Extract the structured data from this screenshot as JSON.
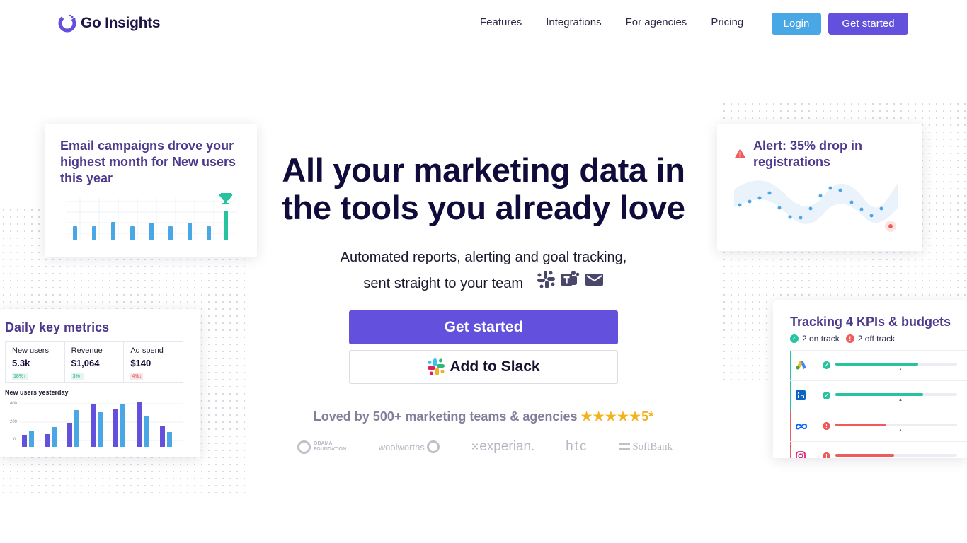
{
  "brand": {
    "name": "Go Insights"
  },
  "nav": {
    "links": [
      "Features",
      "Integrations",
      "For agencies",
      "Pricing"
    ],
    "login": "Login",
    "get_started": "Get started"
  },
  "hero": {
    "title": "All your marketing data in the tools you already love",
    "subtitle_line1": "Automated reports, alerting and goal tracking,",
    "subtitle_line2": "sent straight to your team",
    "cta_primary": "Get started",
    "cta_slack": "Add to Slack",
    "loved": "Loved by 500+ marketing teams & agencies",
    "rating": "5*",
    "customer_logos": [
      "OBAMA FOUNDATION",
      "woolworths",
      "experian.",
      "htc",
      "SoftBank"
    ]
  },
  "email_card": {
    "title": "Email campaigns drove your highest month for New users this year"
  },
  "alert_card": {
    "title": "Alert: 35% drop in registrations"
  },
  "metrics_card": {
    "title": "Daily key metrics",
    "metrics": [
      {
        "label": "New users",
        "value": "5.3k",
        "change": "18%↑"
      },
      {
        "label": "Revenue",
        "value": "$1,064",
        "change": "3%↑"
      },
      {
        "label": "Ad spend",
        "value": "$140",
        "change": "4%↓"
      }
    ],
    "chart_title": "New users yesterday",
    "y_ticks": [
      "400",
      "200",
      "0"
    ]
  },
  "kpi_card": {
    "title": "Tracking 4 KPIs & budgets",
    "on_track": "2 on track",
    "off_track": "2 off track",
    "rows": [
      {
        "source": "Google Ads",
        "icon": "google-ads-icon",
        "status": "on",
        "progress": 0.68
      },
      {
        "source": "LinkedIn",
        "icon": "linkedin-icon",
        "status": "on",
        "progress": 0.72
      },
      {
        "source": "Meta",
        "icon": "meta-icon",
        "status": "off",
        "progress": 0.41
      },
      {
        "source": "Instagram",
        "icon": "instagram-icon",
        "status": "off",
        "progress": 0.48
      }
    ]
  },
  "colors": {
    "primary": "#6351de",
    "login": "#4aa7e6",
    "green": "#27c39f",
    "red": "#ef5a5a",
    "bar_blue": "#4aa7e6",
    "bar_purple": "#6351de"
  }
}
